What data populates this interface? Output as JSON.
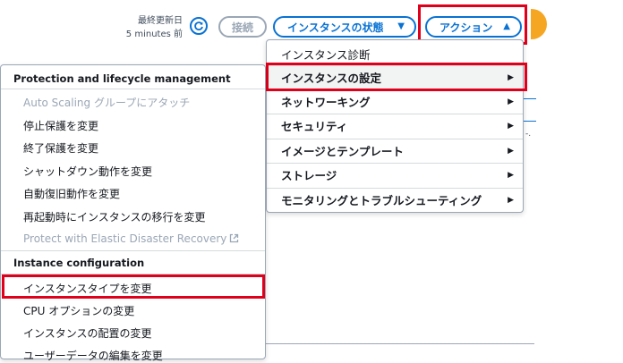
{
  "header": {
    "last_updated_label": "最終更新日",
    "last_updated_value": "5 minutes 前",
    "connect_label": "接続",
    "instance_state_label": "インスタンスの状態",
    "actions_label": "アクション",
    "accent_color": "#0972d3",
    "highlight_color": "#e0001b"
  },
  "actions_menu": {
    "items": [
      {
        "label": "インスタンス診断",
        "has_submenu": false
      },
      {
        "label": "インスタンスの設定",
        "has_submenu": true,
        "selected": true
      },
      {
        "label": "ネットワーキング",
        "has_submenu": true
      },
      {
        "label": "セキュリティ",
        "has_submenu": true
      },
      {
        "label": "イメージとテンプレート",
        "has_submenu": true
      },
      {
        "label": "ストレージ",
        "has_submenu": true
      },
      {
        "label": "モニタリングとトラブルシューティング",
        "has_submenu": true
      }
    ]
  },
  "background": {
    "side_text": "-."
  },
  "settings_submenu": {
    "section_protection": "Protection and lifecycle management",
    "protection_items": [
      {
        "label": "Auto Scaling グループにアタッチ",
        "disabled": true
      },
      {
        "label": "停止保護を変更",
        "disabled": false
      },
      {
        "label": "終了保護を変更",
        "disabled": false
      },
      {
        "label": "シャットダウン動作を変更",
        "disabled": false
      },
      {
        "label": "自動復旧動作を変更",
        "disabled": false
      },
      {
        "label": "再起動時にインスタンスの移行を変更",
        "disabled": false
      },
      {
        "label": "Protect with Elastic Disaster Recovery",
        "disabled": true,
        "icon": "external-link-icon"
      }
    ],
    "section_instance_config": "Instance configuration",
    "config_items": [
      {
        "label": "インスタンスタイプを変更",
        "highlighted": true
      },
      {
        "label": "CPU オプションの変更"
      },
      {
        "label": "インスタンスの配置の変更"
      },
      {
        "label": "ユーザーデータの編集を変更"
      }
    ]
  }
}
